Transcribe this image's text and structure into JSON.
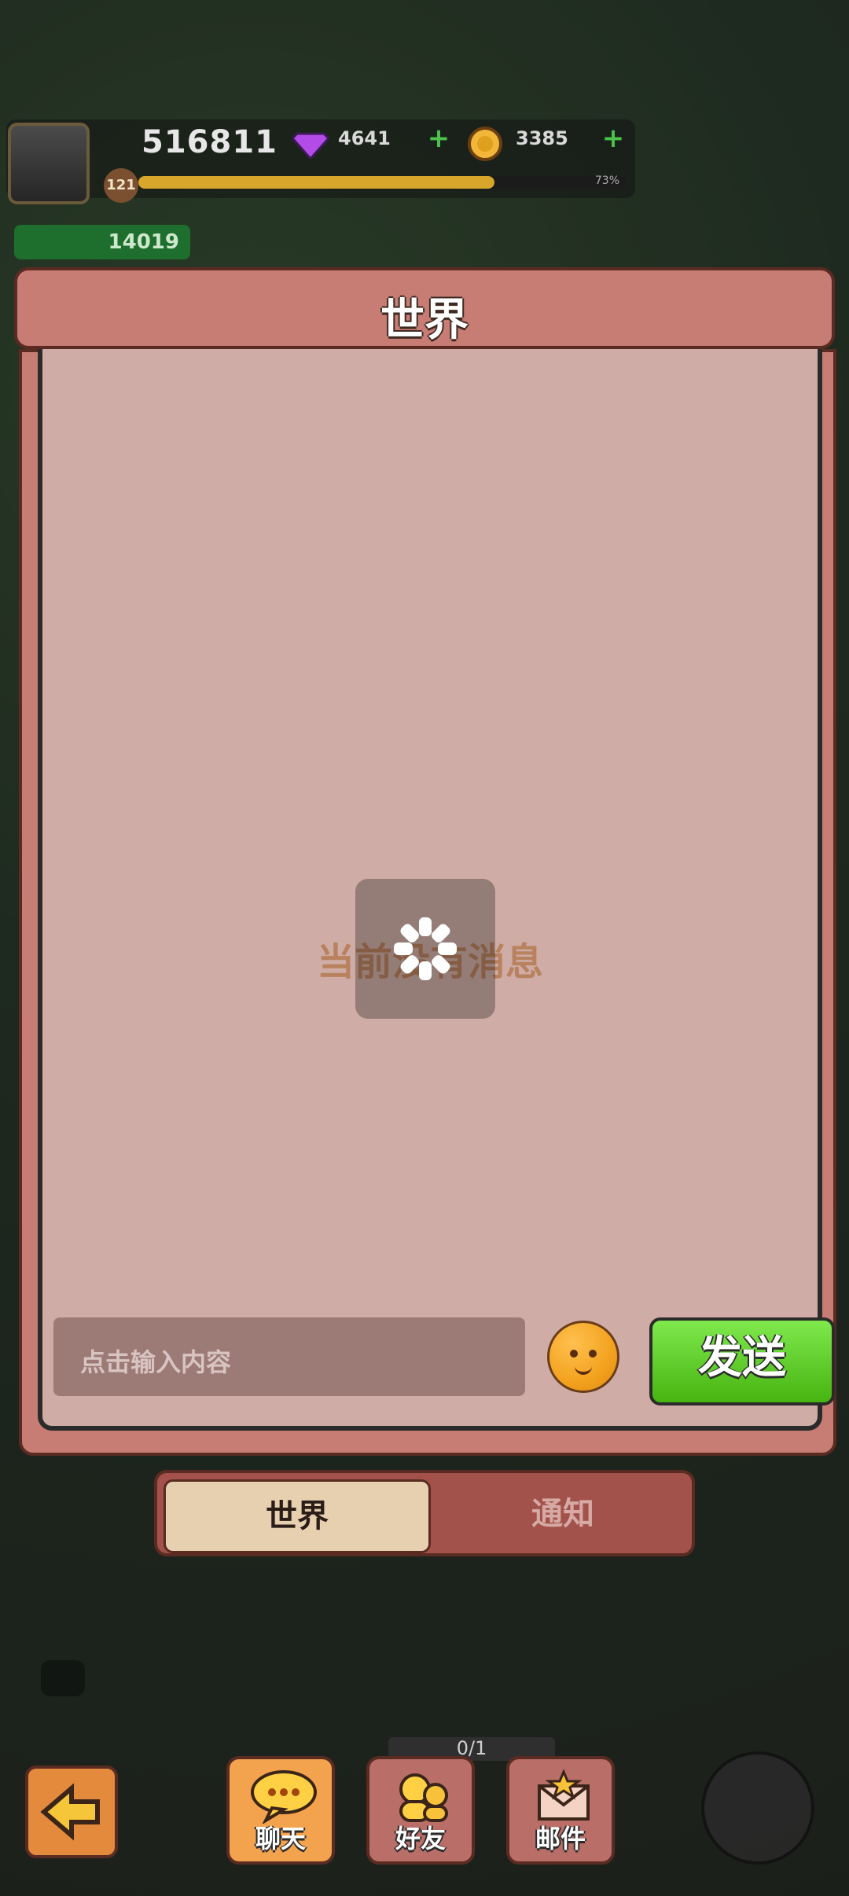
{
  "hud": {
    "power": "516811",
    "gems": "4641",
    "coins": "3385",
    "level": "121",
    "xp_percent_label": "73%",
    "meat": "14019"
  },
  "panel": {
    "title": "世界",
    "empty_message": "当前没有消息"
  },
  "input": {
    "placeholder": "点击输入内容"
  },
  "buttons": {
    "send": "发送"
  },
  "tabs": {
    "world": "世界",
    "notice": "通知"
  },
  "bottom_nav": {
    "chat": "聊天",
    "friends": "好友",
    "mail": "邮件",
    "progress": "0/1"
  },
  "colors": {
    "panel_bg": "#cfada6",
    "accent_green": "#47b411",
    "header": "#c77c74"
  },
  "icons": {
    "gem": "gem-icon",
    "coin": "coin-icon",
    "back": "back-arrow-icon",
    "chat": "chat-bubble-icon",
    "friends": "friends-icon",
    "mail": "mail-icon",
    "emoji": "emoji-icon",
    "loading": "loading-spinner-icon"
  }
}
